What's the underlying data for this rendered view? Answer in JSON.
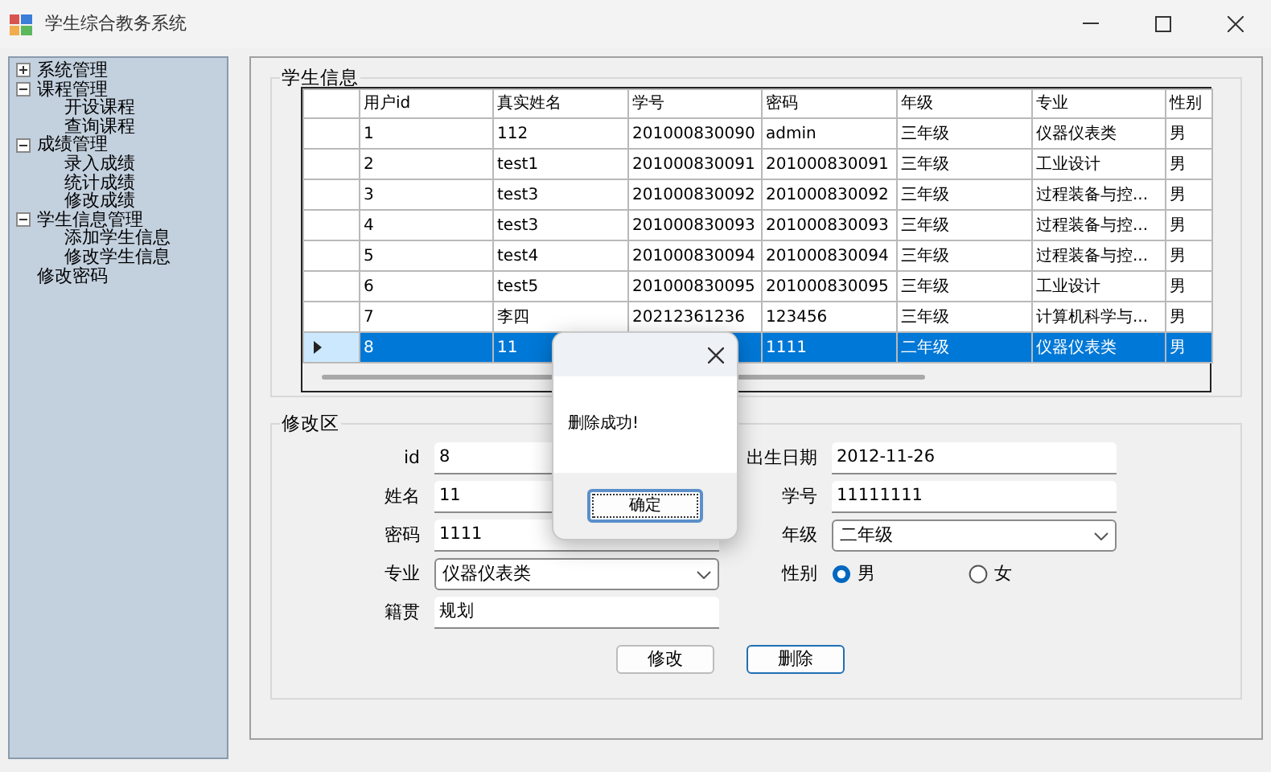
{
  "window": {
    "title": "学生综合教务系统"
  },
  "sidebar": {
    "items": [
      {
        "label": "系统管理",
        "expanded": false
      },
      {
        "label": "课程管理",
        "expanded": true,
        "children": [
          {
            "label": "开设课程"
          },
          {
            "label": "查询课程"
          }
        ]
      },
      {
        "label": "成绩管理",
        "expanded": true,
        "children": [
          {
            "label": "录入成绩"
          },
          {
            "label": "统计成绩"
          },
          {
            "label": "修改成绩"
          }
        ]
      },
      {
        "label": "学生信息管理",
        "expanded": true,
        "children": [
          {
            "label": "添加学生信息"
          },
          {
            "label": "修改学生信息"
          }
        ]
      },
      {
        "label": "修改密码"
      }
    ]
  },
  "student_table": {
    "title": "学生信息",
    "columns": [
      "用户id",
      "真实姓名",
      "学号",
      "密码",
      "年级",
      "专业",
      "性别"
    ],
    "rows": [
      {
        "selected": false,
        "cells": [
          "1",
          "112",
          "201000830090",
          "admin",
          "三年级",
          "仪器仪表类",
          "男"
        ]
      },
      {
        "selected": false,
        "cells": [
          "2",
          "test1",
          "201000830091",
          "201000830091",
          "三年级",
          "工业设计",
          "男"
        ]
      },
      {
        "selected": false,
        "cells": [
          "3",
          "test3",
          "201000830092",
          "201000830092",
          "三年级",
          "过程装备与控...",
          "男"
        ]
      },
      {
        "selected": false,
        "cells": [
          "4",
          "test3",
          "201000830093",
          "201000830093",
          "三年级",
          "过程装备与控...",
          "男"
        ]
      },
      {
        "selected": false,
        "cells": [
          "5",
          "test4",
          "201000830094",
          "201000830094",
          "三年级",
          "过程装备与控...",
          "男"
        ]
      },
      {
        "selected": false,
        "cells": [
          "6",
          "test5",
          "201000830095",
          "201000830095",
          "三年级",
          "工业设计",
          "男"
        ]
      },
      {
        "selected": false,
        "cells": [
          "7",
          "李四",
          "20212361236",
          "123456",
          "三年级",
          "计算机科学与...",
          "男"
        ]
      },
      {
        "selected": true,
        "cells": [
          "8",
          "11",
          null,
          "1111",
          "二年级",
          "仪器仪表类",
          "男"
        ]
      }
    ]
  },
  "edit_form": {
    "title": "修改区",
    "left_fields": [
      {
        "kind": "text",
        "label": "id",
        "value": "8"
      },
      {
        "kind": "text",
        "label": "姓名",
        "value": "11"
      },
      {
        "kind": "text",
        "label": "密码",
        "value": "1111"
      },
      {
        "kind": "select",
        "label": "专业",
        "value": "仪器仪表类"
      },
      {
        "kind": "text",
        "label": "籍贯",
        "value": "规划"
      }
    ],
    "right_fields": [
      {
        "kind": "text",
        "label": "出生日期",
        "value": "2012-11-26"
      },
      {
        "kind": "text",
        "label": "学号",
        "value": "11111111"
      },
      {
        "kind": "select",
        "label": "年级",
        "value": "二年级"
      },
      {
        "kind": "radio",
        "label": "性别",
        "options": [
          {
            "label": "男",
            "selected": true
          },
          {
            "label": "女",
            "selected": false
          }
        ]
      }
    ],
    "buttons": [
      {
        "label": "修改",
        "focused": false
      },
      {
        "label": "删除",
        "focused": true
      }
    ]
  },
  "dialog": {
    "message": "删除成功!",
    "ok_button": "确定"
  }
}
